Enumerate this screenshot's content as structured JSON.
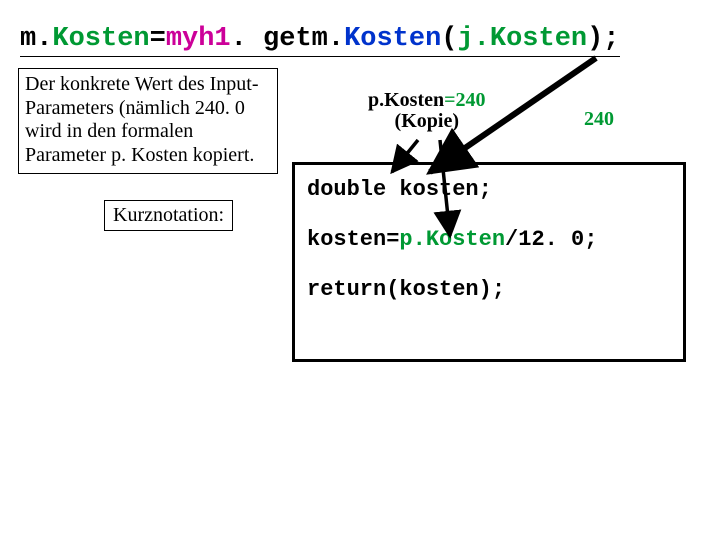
{
  "codeLine": {
    "p1": "m.",
    "p2": "Kosten",
    "p3": "=",
    "p4": "myh1",
    "p5": ". getm.",
    "p6": "Kosten",
    "p7": "(",
    "p8": "j.Kosten",
    "p9": ");"
  },
  "descBox": "Der konkrete Wert des Input-Parameters (nämlich 240. 0 wird in den formalen Parameter p. Kosten kopiert.",
  "kurznotation": "Kurznotation:",
  "pKostenLabel": {
    "lhs": "p.Kosten",
    "eq": "=",
    "rhs": "240",
    "sub": "(Kopie)"
  },
  "value240": "240",
  "codeBox": {
    "line1": "double kosten;",
    "line2a": "kosten=",
    "line2b": "p.Kosten",
    "line2c": "/12. 0;",
    "line3": "return(kosten);"
  }
}
